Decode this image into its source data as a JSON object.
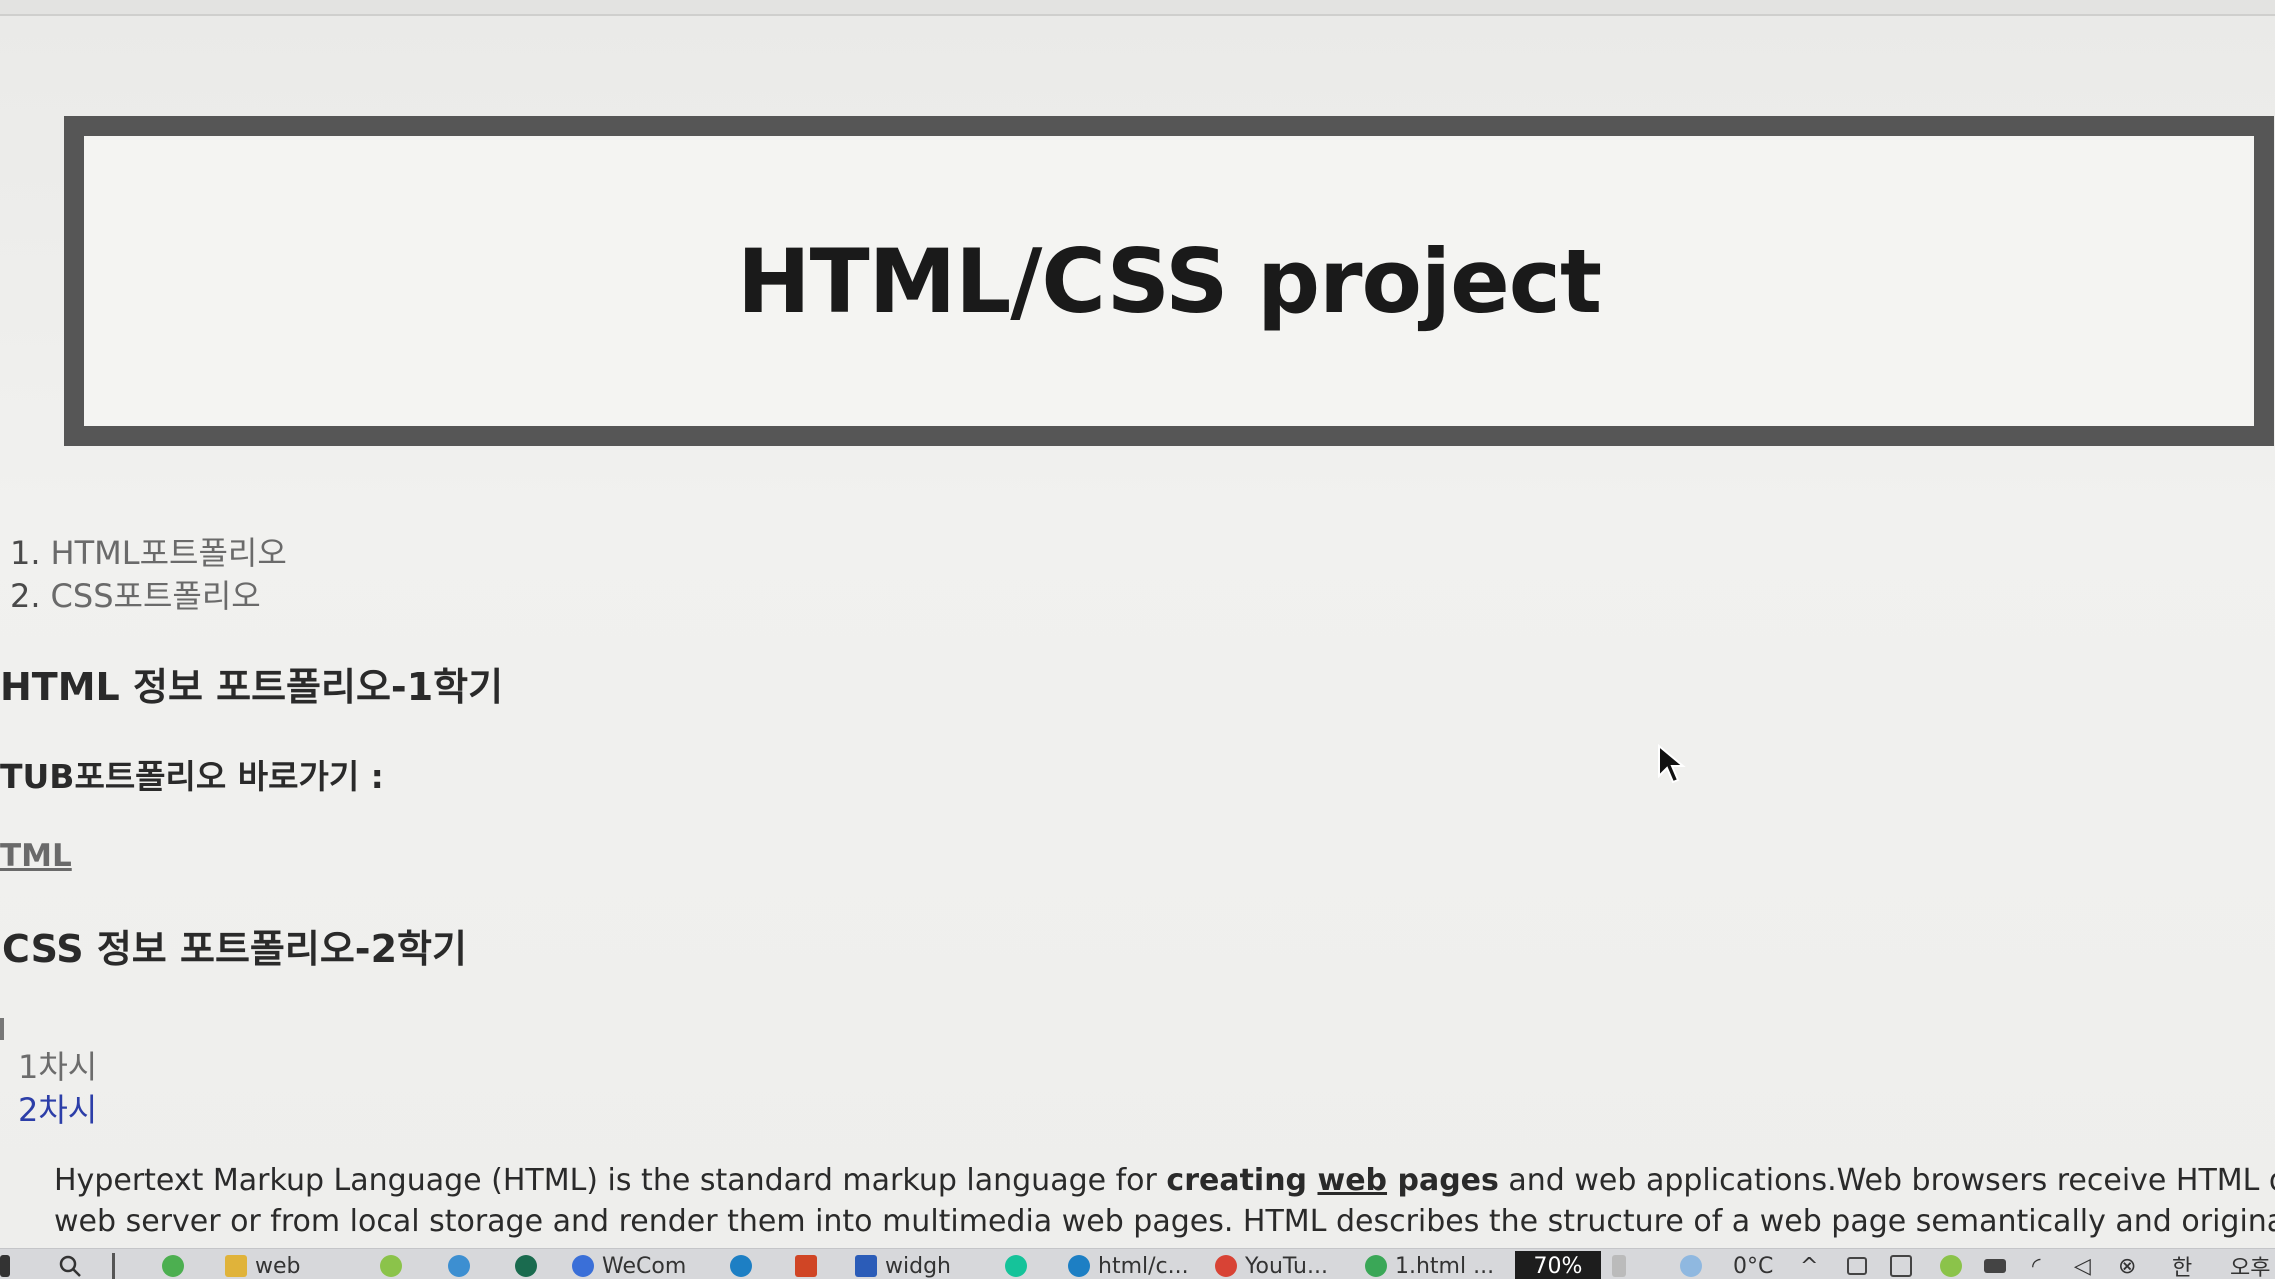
{
  "header": {
    "title": "HTML/CSS project"
  },
  "nav": {
    "items": [
      {
        "num": "1.",
        "label": "HTML포트폴리오"
      },
      {
        "num": "2.",
        "label": "CSS포트폴리오"
      }
    ]
  },
  "html_section": {
    "heading": "HTML 정보 포트폴리오-1학기",
    "tub_label": "TUB포트폴리오 바로가기 :",
    "link": "TML"
  },
  "css_section": {
    "heading": "CSS 정보 포트폴리오-2학기",
    "sessions": [
      "1차시",
      "2차시"
    ]
  },
  "paragraph": {
    "line1_part1": "Hypertext Markup Language (HTML) is the standard markup language for ",
    "line1_bold1": "creating ",
    "line1_bold_underline": "web",
    "line1_bold2": " pages",
    "line1_part2": " and web applications.Web browsers receive HTML documer",
    "line2": "web server or from local storage and render them into multimedia web pages. HTML describes the structure of a web page semantically and originally incl"
  },
  "taskbar": {
    "items": [
      {
        "label": "web",
        "icon": "folder-icon",
        "color": "#e0b33a"
      },
      {
        "label": "WeCom",
        "icon": "search-icon",
        "color": "#3a6fd8"
      },
      {
        "label": "widgh",
        "icon": "word-icon",
        "color": "#2b5cb8"
      },
      {
        "label": "html/c...",
        "icon": "edge-icon",
        "color": "#1d7fc4"
      },
      {
        "label": "YouTu...",
        "icon": "chrome-icon",
        "color": "#d84335"
      },
      {
        "label": "1.html ...",
        "icon": "globe-icon",
        "color": "#3aa757"
      }
    ],
    "battery": "70%",
    "temperature": "0°C",
    "ime": "한",
    "time_prefix": "오후"
  },
  "colors": {
    "header_border": "#565656",
    "visited_link": "#2c3ea8",
    "battery_bg": "#1d1d1d"
  }
}
